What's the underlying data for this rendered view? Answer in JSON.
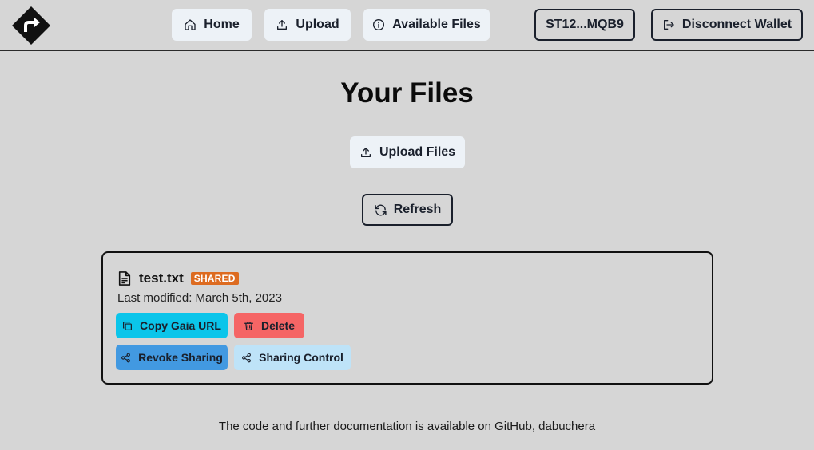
{
  "nav": {
    "home_label": "Home",
    "upload_label": "Upload",
    "available_files_label": "Available Files",
    "wallet_address": "ST12...MQB9",
    "disconnect_label": "Disconnect Wallet"
  },
  "main": {
    "title": "Your Files",
    "upload_files_label": "Upload Files",
    "refresh_label": "Refresh"
  },
  "files": [
    {
      "name": "test.txt",
      "badge": "SHARED",
      "last_modified": "Last modified: March 5th, 2023",
      "actions": {
        "copy": "Copy Gaia URL",
        "delete": "Delete",
        "revoke": "Revoke Sharing",
        "sharing": "Sharing Control"
      }
    }
  ],
  "footer": {
    "text": "The code and further documentation is available on GitHub, dabuchera"
  },
  "colors": {
    "background": "#d6d6d6",
    "shared_badge": "#dd6b20",
    "copy_button": "#0bc5ea",
    "delete_button": "#f56565",
    "revoke_button": "#4299e1",
    "sharing_button": "#bee3f8"
  },
  "icons": {
    "logo": "diamond-arrow-logo",
    "home": "home-icon",
    "upload": "upload-icon",
    "available_files": "info-icon",
    "disconnect": "logout-icon",
    "refresh": "refresh-icon",
    "file": "document-icon",
    "copy": "copy-icon",
    "delete": "trash-icon",
    "share": "share-icon"
  }
}
